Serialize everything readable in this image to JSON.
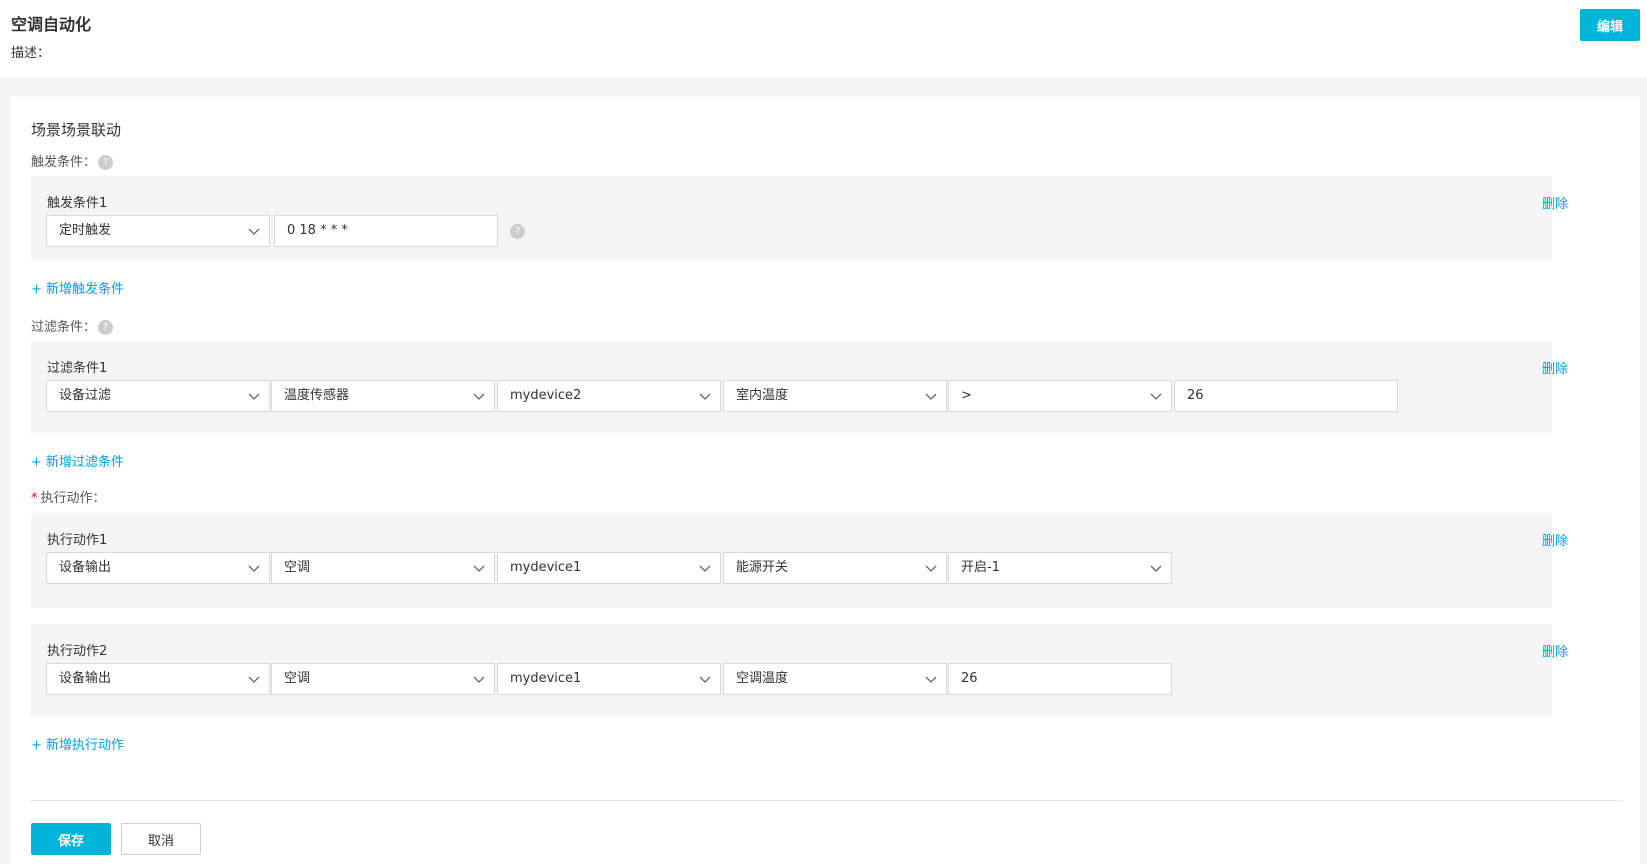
{
  "header": {
    "title": "空调自动化",
    "description_label": "描述：",
    "edit_label": "编辑"
  },
  "section_title": "场景场景联动",
  "trigger": {
    "label": "触发条件：",
    "help": "?",
    "block_title": "触发条件1",
    "type_value": "定时触发",
    "cron_value": "0 18 * * *",
    "delete_label": "删除",
    "add_label": "+ 新增触发条件"
  },
  "filter": {
    "label": "过滤条件：",
    "help": "?",
    "block_title": "过滤条件1",
    "values": [
      "设备过滤",
      "温度传感器",
      "mydevice2",
      "室内温度",
      ">"
    ],
    "threshold": "26",
    "delete_label": "删除",
    "add_label": "+ 新增过滤条件"
  },
  "actions": {
    "required_mark": "*",
    "label": "执行动作：",
    "items": [
      {
        "title": "执行动作1",
        "values": [
          "设备输出",
          "空调",
          "mydevice1",
          "能源开关",
          "开启-1"
        ],
        "delete_label": "删除"
      },
      {
        "title": "执行动作2",
        "values": [
          "设备输出",
          "空调",
          "mydevice1",
          "空调温度"
        ],
        "input_value": "26",
        "delete_label": "删除"
      }
    ],
    "add_label": "+ 新增执行动作"
  },
  "footer": {
    "save_label": "保存",
    "cancel_label": "取消"
  },
  "icons": {
    "chevron": "chevron-down-icon",
    "help": "help-circle-icon"
  },
  "colors": {
    "accent": "#00b5d9",
    "link": "#00a0e0",
    "block_bg": "#f5f5f5"
  }
}
